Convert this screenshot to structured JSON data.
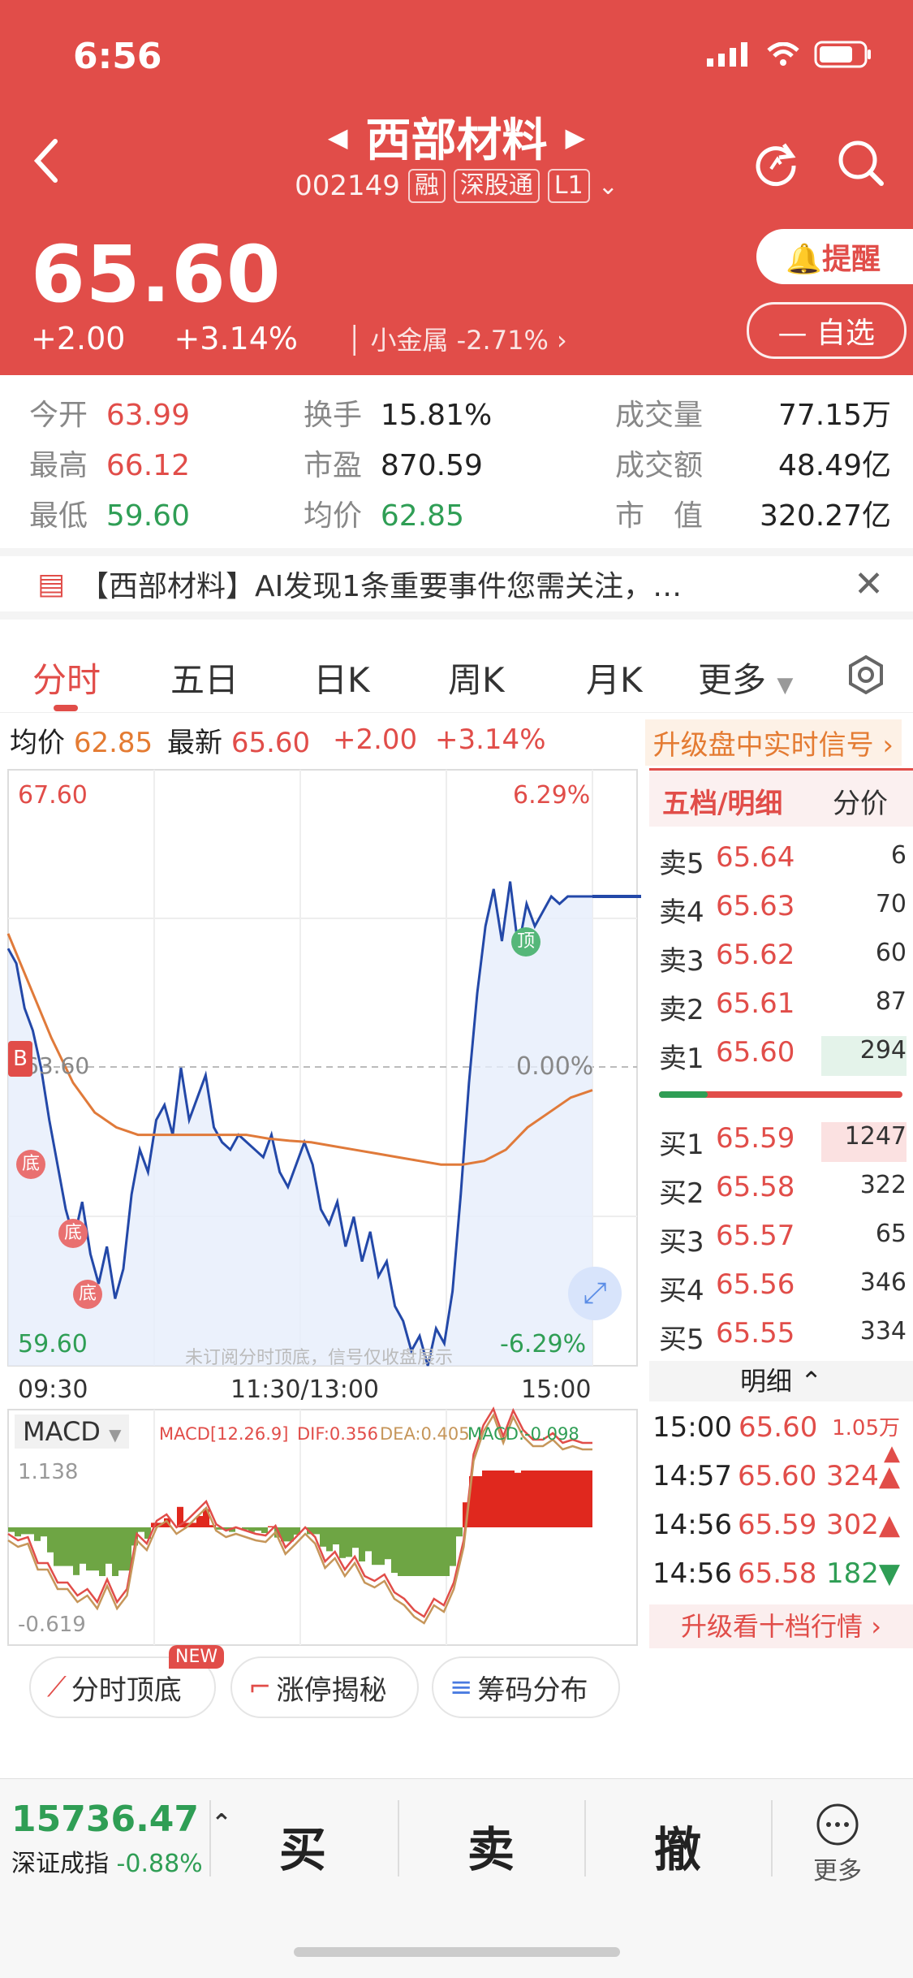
{
  "status": {
    "time": "6:56"
  },
  "header": {
    "name": "西部材料",
    "code": "002149",
    "tags": [
      "融",
      "深股通",
      "L1"
    ],
    "price": "65.60",
    "change": "+2.00",
    "change_pct": "+3.14%",
    "sector": "小金属",
    "sector_pct": "-2.71%",
    "remind_label": "提醒",
    "watchlist_label": "自选"
  },
  "stats": [
    {
      "label": "今开",
      "value": "63.99",
      "color": "red"
    },
    {
      "label": "最高",
      "value": "66.12",
      "color": "red"
    },
    {
      "label": "最低",
      "value": "59.60",
      "color": "green"
    },
    {
      "label": "换手",
      "value": "15.81%"
    },
    {
      "label": "市盈",
      "value": "870.59"
    },
    {
      "label": "均价",
      "value": "62.85",
      "color": "green"
    },
    {
      "label": "成交量",
      "value": "77.15万"
    },
    {
      "label": "成交额",
      "value": "48.49亿"
    },
    {
      "label": "市　值",
      "value": "320.27亿"
    }
  ],
  "notice": {
    "text": "【西部材料】AI发现1条重要事件您需关注，…"
  },
  "tabs": [
    "分时",
    "五日",
    "日K",
    "周K",
    "月K",
    "更多"
  ],
  "pricebar": {
    "avg_label": "均价",
    "avg": "62.85",
    "latest_label": "最新",
    "latest": "65.60",
    "change": "+2.00",
    "change_pct": "+3.14%",
    "upgrade": "升级盘中实时信号"
  },
  "chart_data": {
    "type": "line",
    "y_high": "67.60",
    "y_low": "59.60",
    "y_mid": "63.60",
    "pct_high": "6.29%",
    "pct_low": "-6.29%",
    "pct_mid": "0.00%",
    "x_labels": [
      "09:30",
      "11:30/13:00",
      "15:00"
    ],
    "watermark": "未订阅分时顶底，信号仅收盘展示",
    "markers": {
      "bottom": "底",
      "top": "顶",
      "b": "B"
    },
    "price": [
      65.2,
      65.0,
      64.4,
      64.1,
      63.6,
      62.9,
      62.3,
      61.7,
      61.3,
      61.8,
      61.1,
      60.7,
      61.2,
      60.5,
      60.9,
      61.9,
      62.5,
      62.2,
      62.9,
      63.1,
      62.7,
      63.6,
      62.9,
      63.2,
      63.5,
      62.8,
      62.6,
      62.5,
      62.7,
      62.6,
      62.5,
      62.4,
      62.7,
      62.2,
      62.0,
      62.3,
      62.6,
      62.3,
      61.7,
      61.5,
      61.8,
      61.2,
      61.6,
      61.0,
      61.4,
      60.8,
      61.0,
      60.4,
      60.2,
      59.8,
      60.0,
      59.6,
      60.1,
      59.9,
      60.6,
      61.9,
      63.4,
      64.6,
      65.5,
      66.0,
      65.3,
      66.1,
      65.2,
      65.8,
      65.5,
      65.7,
      65.9,
      65.8,
      65.9,
      65.9,
      65.9,
      65.9
    ],
    "avg_line": [
      65.4,
      64.7,
      64.0,
      63.4,
      63.0,
      62.8,
      62.7,
      62.7,
      62.7,
      62.7,
      62.7,
      62.7,
      62.65,
      62.62,
      62.6,
      62.55,
      62.5,
      62.45,
      62.4,
      62.35,
      62.3,
      62.3,
      62.35,
      62.5,
      62.8,
      63.0,
      63.2,
      63.3
    ],
    "macd_label": "MACD",
    "macd_max": "1.138",
    "macd_min": "-0.619",
    "macd_params": "MACD[12.26.9]",
    "dif": "DIF:0.356",
    "dea": "DEA:0.405",
    "macd": "MACD:-0.098"
  },
  "orderbook": {
    "title": "五档/明细",
    "tab2": "分价",
    "asks": [
      {
        "label": "卖5",
        "price": "65.64",
        "vol": "6"
      },
      {
        "label": "卖4",
        "price": "65.63",
        "vol": "70"
      },
      {
        "label": "卖3",
        "price": "65.62",
        "vol": "60"
      },
      {
        "label": "卖2",
        "price": "65.61",
        "vol": "87"
      },
      {
        "label": "卖1",
        "price": "65.60",
        "vol": "294"
      }
    ],
    "bids": [
      {
        "label": "买1",
        "price": "65.59",
        "vol": "1247"
      },
      {
        "label": "买2",
        "price": "65.58",
        "vol": "322"
      },
      {
        "label": "买3",
        "price": "65.57",
        "vol": "65"
      },
      {
        "label": "买4",
        "price": "65.56",
        "vol": "346"
      },
      {
        "label": "买5",
        "price": "65.55",
        "vol": "334"
      }
    ],
    "detail_title": "明细",
    "ticks": [
      {
        "time": "15:00",
        "price": "65.60",
        "vol": "1.05万",
        "dir": "up"
      },
      {
        "time": "14:57",
        "price": "65.60",
        "vol": "324",
        "dir": "up"
      },
      {
        "time": "14:56",
        "price": "65.59",
        "vol": "302",
        "dir": "up"
      },
      {
        "time": "14:56",
        "price": "65.58",
        "vol": "182",
        "dir": "down"
      }
    ],
    "upgrade": "升级看十档行情"
  },
  "tools": [
    {
      "label": "分时顶底",
      "badge": "NEW"
    },
    {
      "label": "涨停揭秘"
    },
    {
      "label": "筹码分布"
    }
  ],
  "bottom": {
    "index_value": "15736.47",
    "index_name": "深证成指",
    "index_pct": "-0.88%",
    "buy": "买",
    "sell": "卖",
    "cancel": "撤",
    "more": "更多"
  }
}
